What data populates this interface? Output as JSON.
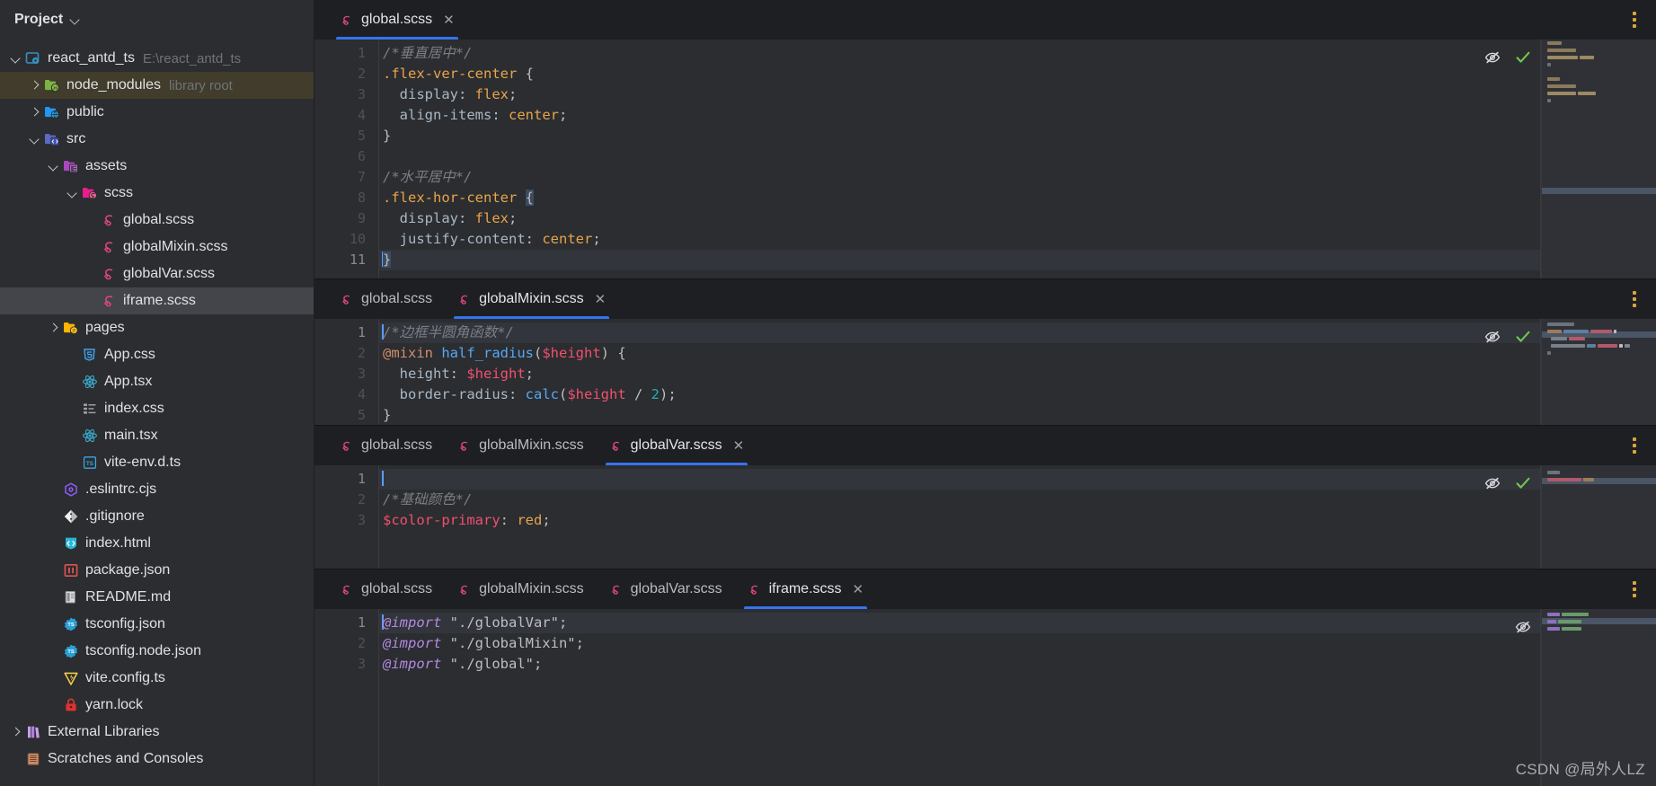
{
  "sidebar": {
    "title": "Project",
    "chevron_icon": "chevron-down-icon",
    "tree": [
      {
        "label": "react_antd_ts",
        "sub": "E:\\react_antd_ts",
        "icon": "project-module-icon",
        "arrow": "open",
        "indent": 0,
        "highlight": "none"
      },
      {
        "label": "node_modules",
        "sub": "library root",
        "icon": "node-folder-icon",
        "arrow": "closed",
        "indent": 1,
        "highlight": "brown"
      },
      {
        "label": "public",
        "sub": "",
        "icon": "public-folder-icon",
        "arrow": "closed",
        "indent": 1,
        "highlight": "none"
      },
      {
        "label": "src",
        "sub": "",
        "icon": "source-folder-icon",
        "arrow": "open",
        "indent": 1,
        "highlight": "none"
      },
      {
        "label": "assets",
        "sub": "",
        "icon": "assets-folder-icon",
        "arrow": "open",
        "indent": 2,
        "highlight": "none"
      },
      {
        "label": "scss",
        "sub": "",
        "icon": "scss-folder-icon",
        "arrow": "open",
        "indent": 3,
        "highlight": "none"
      },
      {
        "label": "global.scss",
        "sub": "",
        "icon": "sass-file-icon",
        "arrow": "none",
        "indent": 4,
        "highlight": "none"
      },
      {
        "label": "globalMixin.scss",
        "sub": "",
        "icon": "sass-file-icon",
        "arrow": "none",
        "indent": 4,
        "highlight": "none"
      },
      {
        "label": "globalVar.scss",
        "sub": "",
        "icon": "sass-file-icon",
        "arrow": "none",
        "indent": 4,
        "highlight": "none"
      },
      {
        "label": "iframe.scss",
        "sub": "",
        "icon": "sass-file-icon",
        "arrow": "none",
        "indent": 4,
        "highlight": "gray"
      },
      {
        "label": "pages",
        "sub": "",
        "icon": "pages-folder-icon",
        "arrow": "closed",
        "indent": 2,
        "highlight": "none"
      },
      {
        "label": "App.css",
        "sub": "",
        "icon": "css-file-icon",
        "arrow": "none",
        "indent": 3,
        "highlight": "none"
      },
      {
        "label": "App.tsx",
        "sub": "",
        "icon": "react-file-icon",
        "arrow": "none",
        "indent": 3,
        "highlight": "none"
      },
      {
        "label": "index.css",
        "sub": "",
        "icon": "stylesheet-list-icon",
        "arrow": "none",
        "indent": 3,
        "highlight": "none"
      },
      {
        "label": "main.tsx",
        "sub": "",
        "icon": "react-file-icon",
        "arrow": "none",
        "indent": 3,
        "highlight": "none"
      },
      {
        "label": "vite-env.d.ts",
        "sub": "",
        "icon": "typescript-decl-icon",
        "arrow": "none",
        "indent": 3,
        "highlight": "none"
      },
      {
        "label": ".eslintrc.cjs",
        "sub": "",
        "icon": "eslint-file-icon",
        "arrow": "none",
        "indent": 2,
        "highlight": "none"
      },
      {
        "label": ".gitignore",
        "sub": "",
        "icon": "git-file-icon",
        "arrow": "none",
        "indent": 2,
        "highlight": "none"
      },
      {
        "label": "index.html",
        "sub": "",
        "icon": "html-file-icon",
        "arrow": "none",
        "indent": 2,
        "highlight": "none"
      },
      {
        "label": "package.json",
        "sub": "",
        "icon": "npm-file-icon",
        "arrow": "none",
        "indent": 2,
        "highlight": "none"
      },
      {
        "label": "README.md",
        "sub": "",
        "icon": "markdown-file-icon",
        "arrow": "none",
        "indent": 2,
        "highlight": "none"
      },
      {
        "label": "tsconfig.json",
        "sub": "",
        "icon": "tsconfig-file-icon",
        "arrow": "none",
        "indent": 2,
        "highlight": "none"
      },
      {
        "label": "tsconfig.node.json",
        "sub": "",
        "icon": "tsconfig-file-icon",
        "arrow": "none",
        "indent": 2,
        "highlight": "none"
      },
      {
        "label": "vite.config.ts",
        "sub": "",
        "icon": "vite-file-icon",
        "arrow": "none",
        "indent": 2,
        "highlight": "none"
      },
      {
        "label": "yarn.lock",
        "sub": "",
        "icon": "lock-file-icon",
        "arrow": "none",
        "indent": 2,
        "highlight": "none"
      },
      {
        "label": "External Libraries",
        "sub": "",
        "icon": "libraries-icon",
        "arrow": "closed",
        "indent": 0,
        "highlight": "none"
      },
      {
        "label": "Scratches and Consoles",
        "sub": "",
        "icon": "scratches-icon",
        "arrow": "none",
        "indent": 0,
        "highlight": "none"
      }
    ]
  },
  "panes": [
    {
      "id": "pane-global",
      "tabs": [
        {
          "label": "global.scss",
          "active": true,
          "closable": true
        }
      ],
      "menu_icon": "more-options-icon",
      "inspection_icon": "hide-inspections-eye-icon",
      "status_icon": "analysis-ok-check-icon",
      "lines": [
        {
          "n": "1",
          "swatch": null,
          "cur": false
        },
        {
          "n": "2",
          "swatch": null,
          "cur": false
        },
        {
          "n": "3",
          "swatch": null,
          "cur": false
        },
        {
          "n": "4",
          "swatch": null,
          "cur": false
        },
        {
          "n": "5",
          "swatch": null,
          "cur": false
        },
        {
          "n": "6",
          "swatch": null,
          "cur": false
        },
        {
          "n": "7",
          "swatch": null,
          "cur": false
        },
        {
          "n": "8",
          "swatch": null,
          "cur": false
        },
        {
          "n": "9",
          "swatch": null,
          "cur": false
        },
        {
          "n": "10",
          "swatch": null,
          "cur": false
        },
        {
          "n": "11",
          "swatch": null,
          "cur": true
        }
      ],
      "code_text": [
        "/*垂直居中*/",
        ".flex-ver-center {",
        "  display: flex;",
        "  align-items: center;",
        "}",
        "",
        "/*水平居中*/",
        ".flex-hor-center {",
        "  display: flex;",
        "  justify-content: center;",
        "}"
      ]
    },
    {
      "id": "pane-globalmixin",
      "tabs": [
        {
          "label": "global.scss",
          "active": false,
          "closable": false
        },
        {
          "label": "globalMixin.scss",
          "active": true,
          "closable": true
        }
      ],
      "menu_icon": "more-options-icon",
      "inspection_icon": "hide-inspections-eye-icon",
      "status_icon": "analysis-ok-check-icon",
      "lines": [
        {
          "n": "1",
          "swatch": null,
          "cur": true
        },
        {
          "n": "2",
          "swatch": null,
          "cur": false
        },
        {
          "n": "3",
          "swatch": null,
          "cur": false
        },
        {
          "n": "4",
          "swatch": null,
          "cur": false
        },
        {
          "n": "5",
          "swatch": null,
          "cur": false
        }
      ],
      "code_text": [
        "/*边框半圆角函数*/",
        "@mixin half_radius($height) {",
        "  height: $height;",
        "  border-radius: calc($height / 2);",
        "}"
      ]
    },
    {
      "id": "pane-globalvar",
      "tabs": [
        {
          "label": "global.scss",
          "active": false,
          "closable": false
        },
        {
          "label": "globalMixin.scss",
          "active": false,
          "closable": false
        },
        {
          "label": "globalVar.scss",
          "active": true,
          "closable": true
        }
      ],
      "menu_icon": "more-options-icon",
      "inspection_icon": "hide-inspections-eye-icon",
      "status_icon": "analysis-ok-check-icon",
      "lines": [
        {
          "n": "1",
          "swatch": null,
          "cur": true
        },
        {
          "n": "2",
          "swatch": null,
          "cur": false
        },
        {
          "n": "3",
          "swatch": "#ff0000",
          "cur": false
        }
      ],
      "code_text": [
        "",
        "/*基础颜色*/",
        "$color-primary: red;"
      ]
    },
    {
      "id": "pane-iframe",
      "tabs": [
        {
          "label": "global.scss",
          "active": false,
          "closable": false
        },
        {
          "label": "globalMixin.scss",
          "active": false,
          "closable": false
        },
        {
          "label": "globalVar.scss",
          "active": false,
          "closable": false
        },
        {
          "label": "iframe.scss",
          "active": true,
          "closable": true
        }
      ],
      "menu_icon": "more-options-icon",
      "inspection_icon": "hide-inspections-eye-icon",
      "status_icon": "",
      "lines": [
        {
          "n": "1",
          "swatch": null,
          "cur": true
        },
        {
          "n": "2",
          "swatch": null,
          "cur": false
        },
        {
          "n": "3",
          "swatch": null,
          "cur": false
        }
      ],
      "code_text": [
        "@import \"./globalVar\";",
        "@import \"./globalMixin\";",
        "@import \"./global\";"
      ]
    }
  ],
  "watermark": "CSDN @局外人LZ",
  "colors": {
    "accent_tab_underline": "#3574f0",
    "sidebar_bg": "#2b2d30",
    "editor_bg": "#2b2d30",
    "tabbar_bg": "#1e1f22",
    "color_primary_swatch": "#ff0000",
    "menu_dots": "#d9a441",
    "check_green": "#6aab73"
  }
}
